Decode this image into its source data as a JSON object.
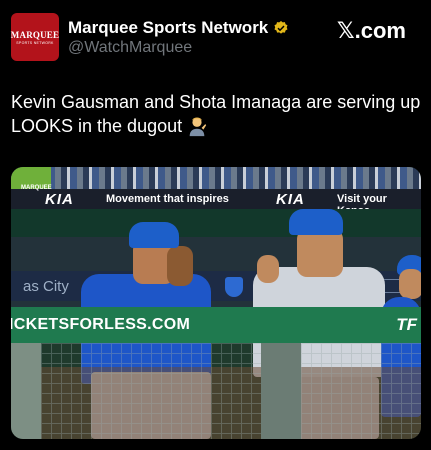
{
  "account": {
    "avatar_brand": "MARQUEE",
    "avatar_sub": "SPORTS NETWORK",
    "display_name": "Marquee Sports Network",
    "handle": "@WatchMarquee",
    "platform_logo": ".com",
    "platform_logo_glyph": "𝕏"
  },
  "tweet": {
    "text": "Kevin Gausman and Shota Imanaga are serving up LOOKS in the dugout",
    "emoji": "person-tipping-hand-icon"
  },
  "media": {
    "ribbon_left": "Movement that inspires",
    "ribbon_right": "Visit your Kansa",
    "ribbon_brand": "KIA",
    "wall_text": "as City",
    "rail_ad": "ICKETSFORLESS.COM",
    "rail_right": "TF",
    "watermark": "MARQUEE",
    "colors": {
      "cubs_blue": "#1e56c8",
      "rail_green": "#1f7a4f",
      "verified_gold": "#e2b719"
    }
  }
}
